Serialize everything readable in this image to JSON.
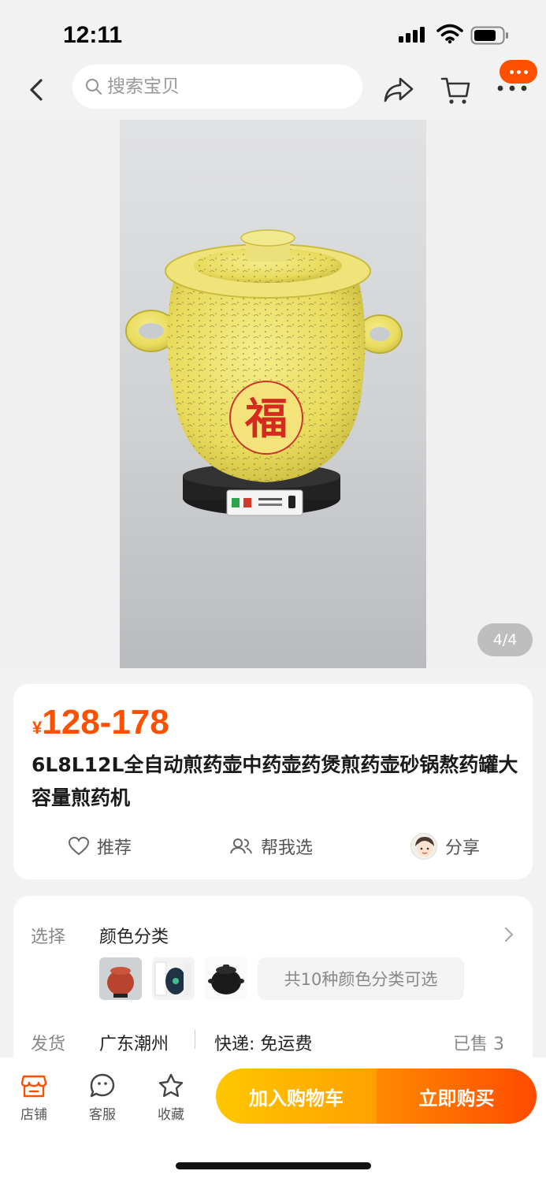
{
  "status": {
    "time": "12:11"
  },
  "search": {
    "placeholder": "搜索宝贝"
  },
  "gallery": {
    "counter": "4/4",
    "emblem_char": "福"
  },
  "product": {
    "currency_symbol": "¥",
    "price": "128-178",
    "title": "6L8L12L全自动煎药壶中药壶药煲煎药壶砂锅熬药罐大容量煎药机"
  },
  "actions": {
    "recommend": "推荐",
    "help_choose": "帮我选",
    "share": "分享"
  },
  "options": {
    "select_label": "选择",
    "select_value": "颜色分类",
    "more_colors": "共10种颜色分类可选",
    "ship_label": "发货",
    "ship_origin": "广东潮州",
    "ship_method": "快递: 免运费",
    "sold": "已售 3"
  },
  "bottom_bar": {
    "shop": "店铺",
    "service": "客服",
    "favorite": "收藏",
    "add_to_cart": "加入购物车",
    "buy_now": "立即购买"
  },
  "colors": {
    "accent": "#ff5000",
    "cart_button": "#ffb000",
    "buy_button": "#ff5a00"
  }
}
